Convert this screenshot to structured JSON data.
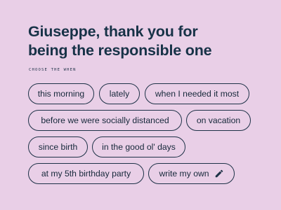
{
  "header": {
    "title_line1": "Giuseppe, thank you for",
    "title_line2": "being the responsible one",
    "eyebrow": "CHOOSE THE WHEN"
  },
  "options": [
    {
      "label": "this morning"
    },
    {
      "label": "lately"
    },
    {
      "label": "when I needed it most"
    },
    {
      "label": "before we were socially distanced"
    },
    {
      "label": "on vacation"
    },
    {
      "label": "since birth"
    },
    {
      "label": "in the good ol' days"
    },
    {
      "label": "at my 5th birthday party"
    },
    {
      "label": "write my own",
      "icon": "pencil-icon"
    }
  ],
  "colors": {
    "background": "#e9cfe7",
    "text": "#1b2f44",
    "chip_border": "#1e3247"
  }
}
